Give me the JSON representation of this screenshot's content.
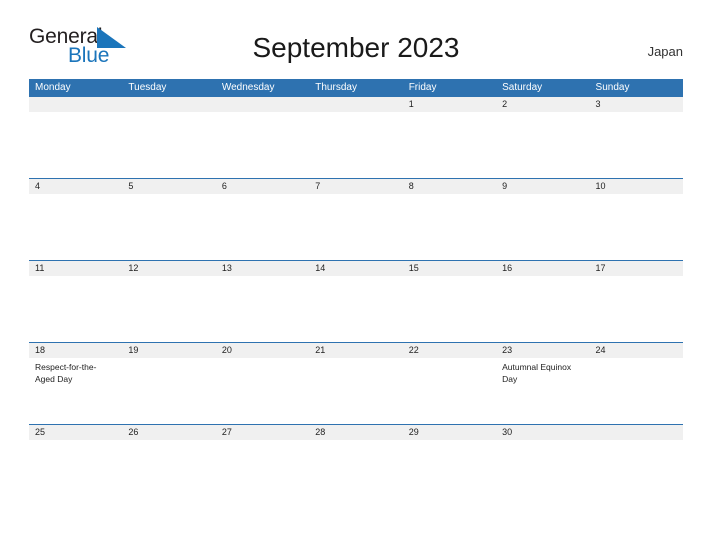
{
  "logo": {
    "word_one": "General",
    "word_two": "Blue",
    "flag_icon": "blue-flag-triangle",
    "dark_color": "#231f20",
    "blue_color": "#1b75bb"
  },
  "header": {
    "title": "September 2023",
    "country": "Japan"
  },
  "theme": {
    "header_blue": "#2e72b0",
    "date_band_gray": "#f0f0f0",
    "text_dark": "#222222"
  },
  "calendar": {
    "weekdays": [
      "Monday",
      "Tuesday",
      "Wednesday",
      "Thursday",
      "Friday",
      "Saturday",
      "Sunday"
    ],
    "weeks": [
      {
        "days": [
          {
            "date": "",
            "event": ""
          },
          {
            "date": "",
            "event": ""
          },
          {
            "date": "",
            "event": ""
          },
          {
            "date": "",
            "event": ""
          },
          {
            "date": "1",
            "event": ""
          },
          {
            "date": "2",
            "event": ""
          },
          {
            "date": "3",
            "event": ""
          }
        ]
      },
      {
        "days": [
          {
            "date": "4",
            "event": ""
          },
          {
            "date": "5",
            "event": ""
          },
          {
            "date": "6",
            "event": ""
          },
          {
            "date": "7",
            "event": ""
          },
          {
            "date": "8",
            "event": ""
          },
          {
            "date": "9",
            "event": ""
          },
          {
            "date": "10",
            "event": ""
          }
        ]
      },
      {
        "days": [
          {
            "date": "11",
            "event": ""
          },
          {
            "date": "12",
            "event": ""
          },
          {
            "date": "13",
            "event": ""
          },
          {
            "date": "14",
            "event": ""
          },
          {
            "date": "15",
            "event": ""
          },
          {
            "date": "16",
            "event": ""
          },
          {
            "date": "17",
            "event": ""
          }
        ]
      },
      {
        "days": [
          {
            "date": "18",
            "event": "Respect-for-the-Aged Day"
          },
          {
            "date": "19",
            "event": ""
          },
          {
            "date": "20",
            "event": ""
          },
          {
            "date": "21",
            "event": ""
          },
          {
            "date": "22",
            "event": ""
          },
          {
            "date": "23",
            "event": "Autumnal Equinox Day"
          },
          {
            "date": "24",
            "event": ""
          }
        ]
      },
      {
        "days": [
          {
            "date": "25",
            "event": ""
          },
          {
            "date": "26",
            "event": ""
          },
          {
            "date": "27",
            "event": ""
          },
          {
            "date": "28",
            "event": ""
          },
          {
            "date": "29",
            "event": ""
          },
          {
            "date": "30",
            "event": ""
          },
          {
            "date": "",
            "event": ""
          }
        ]
      }
    ]
  }
}
